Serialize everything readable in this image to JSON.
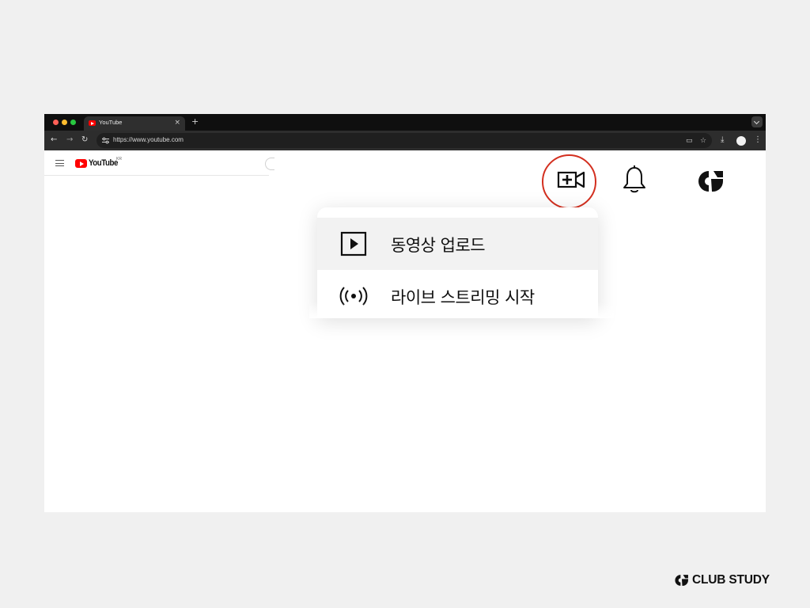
{
  "browser": {
    "tab_title": "YouTube",
    "tab_close": "×",
    "new_tab": "+",
    "url": "https://www.youtube.com",
    "colors": {
      "tabbar": "#0f0f0f",
      "toolbar": "#2d2d2d",
      "accent_ring": "#d32f1f"
    }
  },
  "youtube": {
    "logo_text": "YouTube",
    "region": "KR",
    "icons": [
      "menu-icon",
      "create-video-icon",
      "bell-icon",
      "avatar-logo"
    ]
  },
  "create_menu": {
    "items": [
      {
        "label": "동영상 업로드",
        "icon": "play-box-icon"
      },
      {
        "label": "라이브 스트리밍 시작",
        "icon": "live-broadcast-icon"
      }
    ]
  },
  "watermark": {
    "text": "CLUB STUDY"
  }
}
